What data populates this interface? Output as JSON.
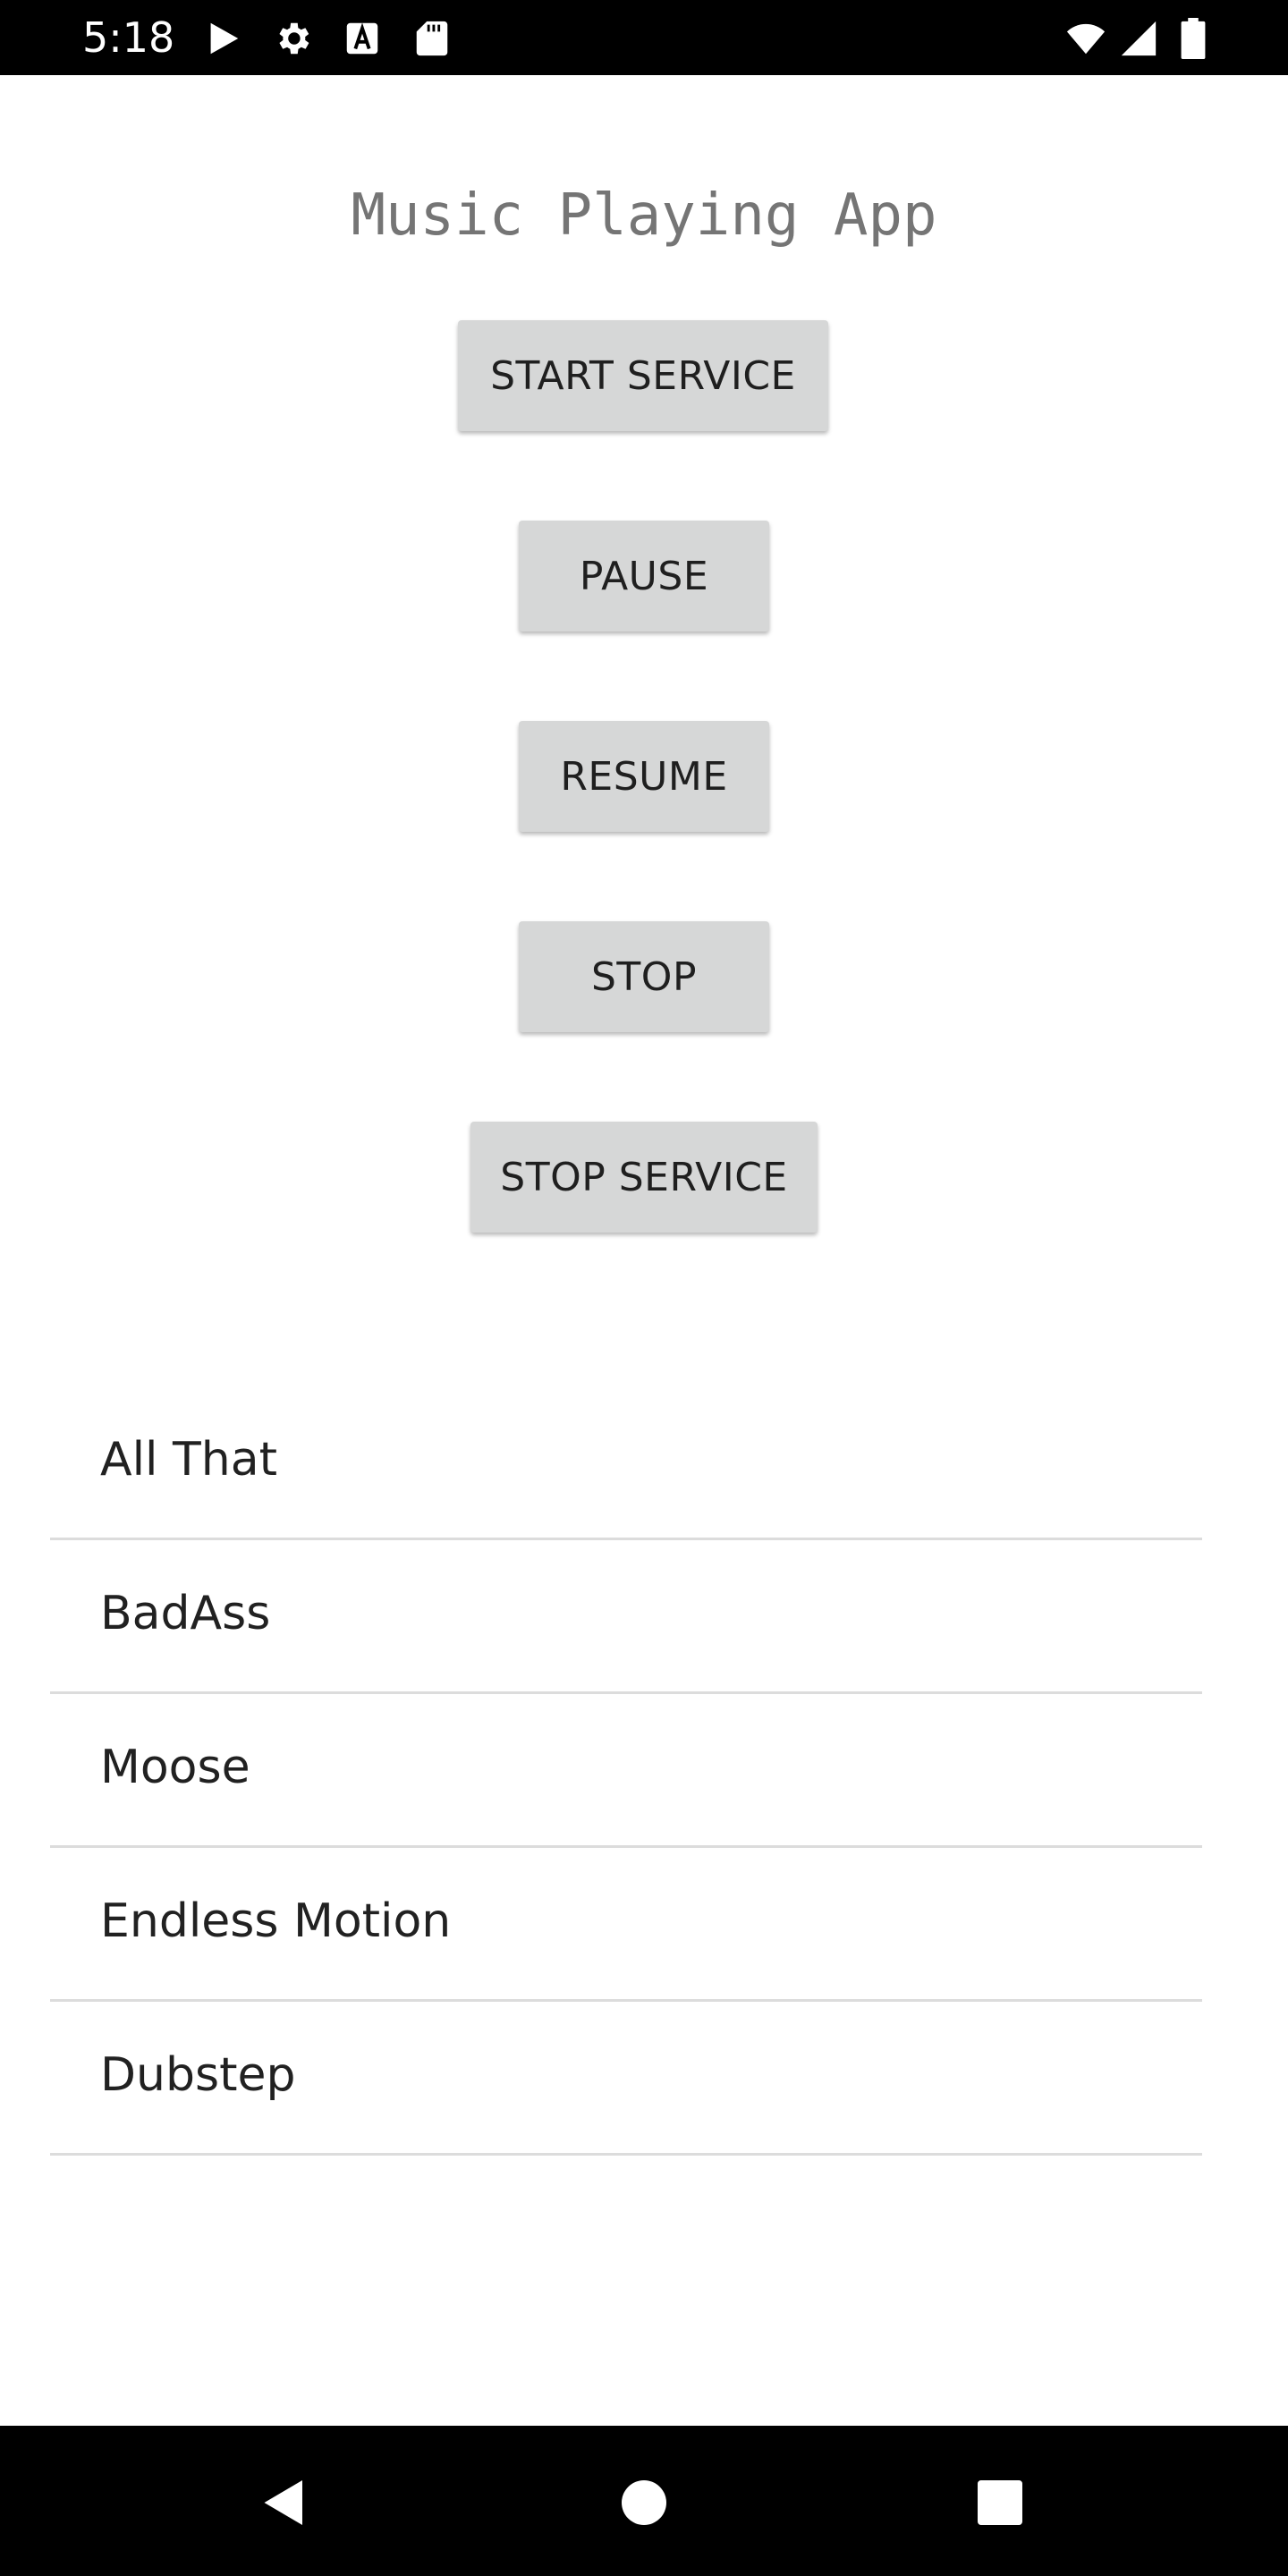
{
  "status_bar": {
    "time": "5:18",
    "left_icons": [
      "play-store-icon",
      "settings-gear-icon",
      "font-a-icon",
      "sd-card-icon"
    ],
    "right_icons": [
      "wifi-icon",
      "cell-signal-icon",
      "battery-icon"
    ]
  },
  "app": {
    "title": "Music Playing App"
  },
  "buttons": {
    "start_service": "START SERVICE",
    "pause": "PAUSE",
    "resume": "RESUME",
    "stop": "STOP",
    "stop_service": "STOP SERVICE"
  },
  "songs": [
    "All That",
    "BadAss",
    "Moose",
    "Endless Motion",
    "Dubstep"
  ],
  "nav_bar": {
    "icons": [
      "back-icon",
      "home-icon",
      "recents-icon"
    ]
  },
  "colors": {
    "status_bar_bg": "#000000",
    "button_bg": "#d6d7d7",
    "title_text": "#757575",
    "divider": "#dcdcdc"
  }
}
